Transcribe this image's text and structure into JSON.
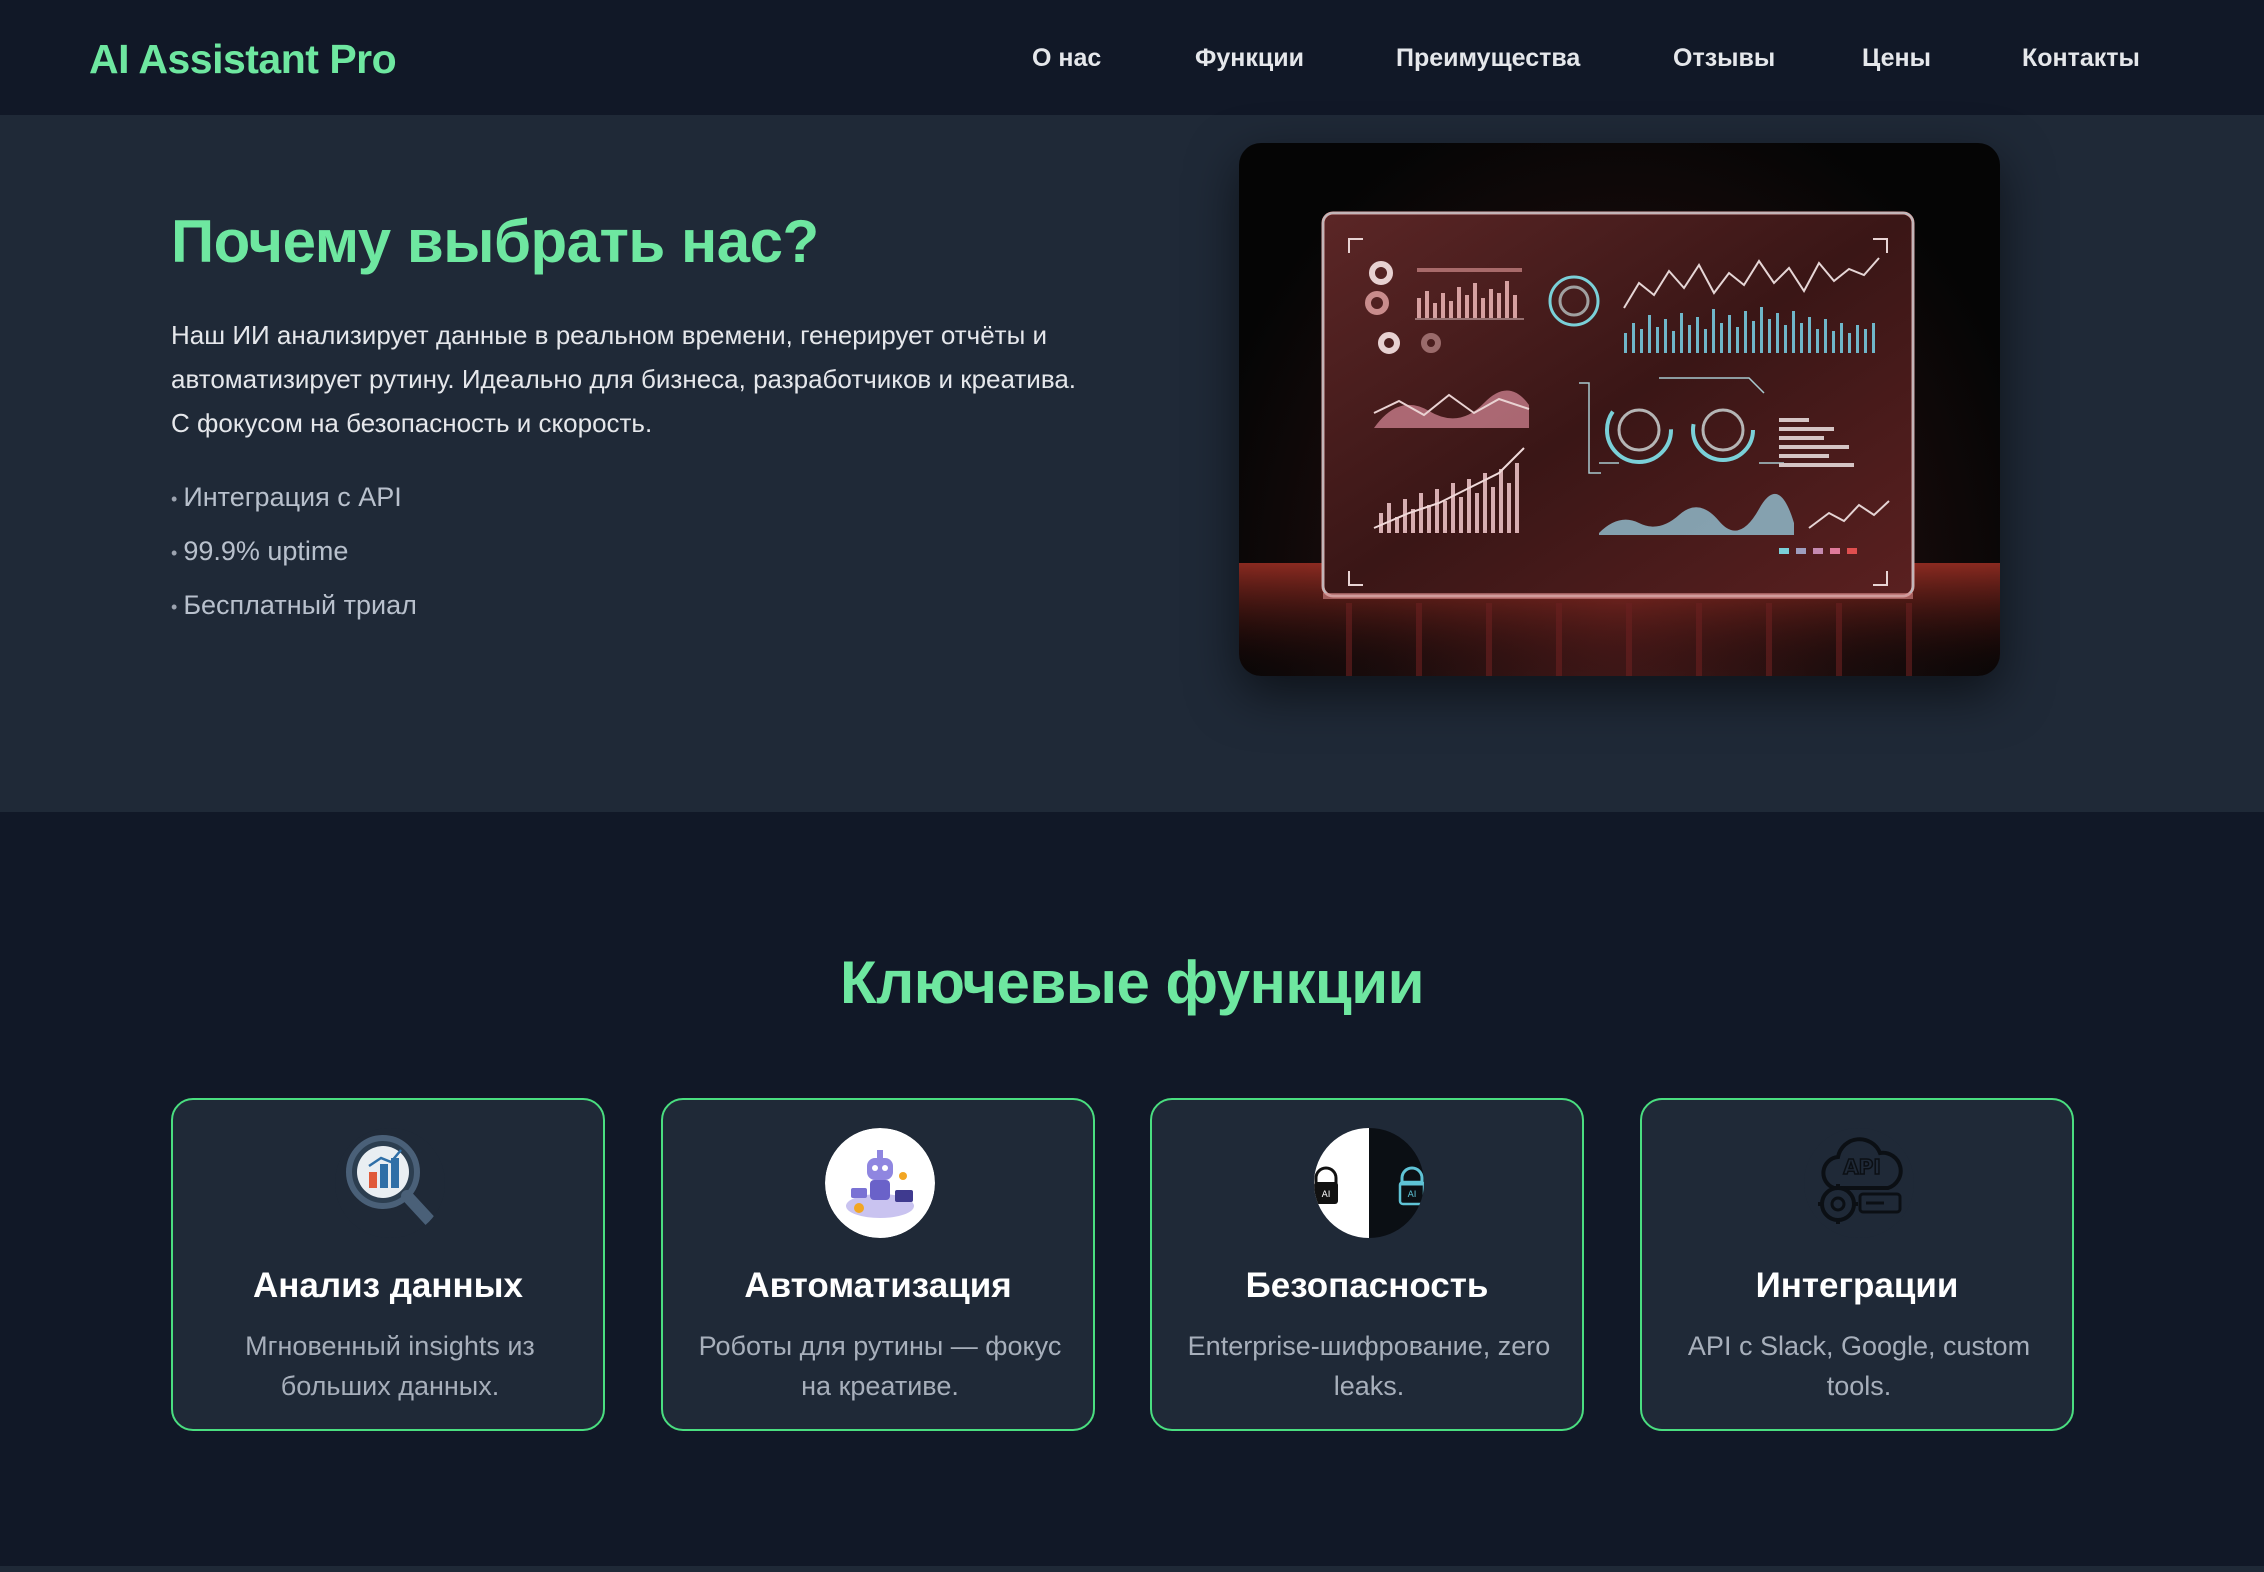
{
  "nav": {
    "logo": "AI Assistant Pro",
    "links": [
      "О нас",
      "Функции",
      "Преимущества",
      "Отзывы",
      "Цены",
      "Контакты"
    ]
  },
  "hero": {
    "title": "Почему выбрать нас?",
    "description": "Наш ИИ анализирует данные в реальном времени, генерирует отчёты и автоматизирует рутину. Идеально для бизнеса, разработчиков и креатива. С фокусом на безопасность и скорость.",
    "bullets": [
      "Интеграция с API",
      "99.9% uptime",
      "Бесплатный триал"
    ]
  },
  "features": {
    "title": "Ключевые функции",
    "cards": [
      {
        "icon": "data-analysis-icon",
        "title": "Анализ данных",
        "desc": "Мгновенный insights из больших данных."
      },
      {
        "icon": "robot-automation-icon",
        "title": "Автоматизация",
        "desc": "Роботы для рутины — фокус на креативе."
      },
      {
        "icon": "security-lock-icon",
        "title": "Безопасность",
        "desc": "Enterprise-шифрование, zero leaks."
      },
      {
        "icon": "api-cloud-icon",
        "title": "Интеграции",
        "desc": "API с Slack, Google, custom tools."
      }
    ]
  },
  "colors": {
    "accent": "#6ee7a0",
    "card_border": "#4ade80",
    "background": "#111827",
    "surface": "#1f2937"
  }
}
